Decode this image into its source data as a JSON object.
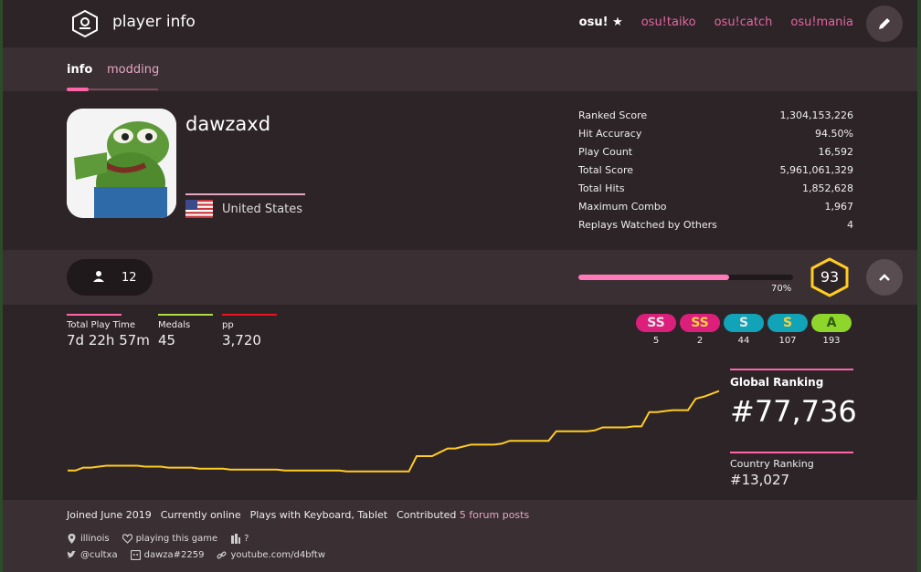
{
  "header": {
    "title": "player info",
    "modes": [
      {
        "label": "osu!",
        "active": true
      },
      {
        "label": "osu!taiko",
        "active": false
      },
      {
        "label": "osu!catch",
        "active": false
      },
      {
        "label": "osu!mania",
        "active": false
      }
    ]
  },
  "tabs": [
    {
      "label": "info"
    },
    {
      "label": "modding"
    }
  ],
  "profile": {
    "username": "dawzaxd",
    "country": "United States"
  },
  "stats": [
    {
      "label": "Ranked Score",
      "value": "1,304,153,226"
    },
    {
      "label": "Hit Accuracy",
      "value": "94.50%"
    },
    {
      "label": "Play Count",
      "value": "16,592"
    },
    {
      "label": "Total Score",
      "value": "5,961,061,329"
    },
    {
      "label": "Total Hits",
      "value": "1,852,628"
    },
    {
      "label": "Maximum Combo",
      "value": "1,967"
    },
    {
      "label": "Replays Watched by Others",
      "value": "4"
    }
  ],
  "level": {
    "followers": "12",
    "progress_label": "70%",
    "progress": 0.7,
    "level": "93"
  },
  "summary": [
    {
      "label": "Total Play Time",
      "value": "7d 22h 57m",
      "color": "#ff66aa"
    },
    {
      "label": "Medals",
      "value": "45",
      "color": "#b3d944"
    },
    {
      "label": "pp",
      "value": "3,720",
      "color": "#ed1121"
    }
  ],
  "grades": [
    {
      "label": "SS",
      "count": "5",
      "bg": "#dc1f7b",
      "fg": "#e6e6e6"
    },
    {
      "label": "SS",
      "count": "2",
      "bg": "#dc1f7b",
      "fg": "#f2d23f"
    },
    {
      "label": "S",
      "count": "44",
      "bg": "#11a3b7",
      "fg": "#e6e6e6"
    },
    {
      "label": "S",
      "count": "107",
      "bg": "#11a3b7",
      "fg": "#f2d23f"
    },
    {
      "label": "A",
      "count": "193",
      "bg": "#8ed62c",
      "fg": "#2e5a12"
    }
  ],
  "ranking": {
    "global_title": "Global Ranking",
    "global_value": "#77,736",
    "country_title": "Country Ranking",
    "country_value": "#13,027"
  },
  "rank_history": [
    0.05,
    0.05,
    0.08,
    0.08,
    0.09,
    0.1,
    0.1,
    0.1,
    0.1,
    0.1,
    0.09,
    0.09,
    0.09,
    0.08,
    0.08,
    0.08,
    0.08,
    0.07,
    0.07,
    0.07,
    0.07,
    0.06,
    0.06,
    0.06,
    0.06,
    0.06,
    0.06,
    0.06,
    0.05,
    0.05,
    0.05,
    0.05,
    0.05,
    0.05,
    0.05,
    0.05,
    0.04,
    0.04,
    0.04,
    0.04,
    0.04,
    0.04,
    0.04,
    0.04,
    0.04,
    0.2,
    0.2,
    0.2,
    0.24,
    0.28,
    0.28,
    0.3,
    0.32,
    0.32,
    0.32,
    0.32,
    0.33,
    0.36,
    0.36,
    0.36,
    0.36,
    0.36,
    0.36,
    0.46,
    0.46,
    0.46,
    0.46,
    0.46,
    0.47,
    0.5,
    0.5,
    0.5,
    0.5,
    0.51,
    0.51,
    0.66,
    0.66,
    0.67,
    0.68,
    0.68,
    0.68,
    0.8,
    0.82,
    0.85,
    0.88
  ],
  "footer": {
    "joined": "Joined June 2019",
    "online": "Currently online",
    "plays_with": "Plays with Keyboard, Tablet",
    "contributed": "Contributed",
    "forum_posts": "5 forum posts",
    "location": "illinois",
    "interests": "playing this game",
    "occupation": "?",
    "twitter": "@cultxa",
    "discord": "dawza#2259",
    "website": "youtube.com/d4bftw"
  },
  "colors": {
    "accent": "#ff66aa",
    "graph_line": "#ffcc22",
    "level_ring": "#ffcc22"
  }
}
